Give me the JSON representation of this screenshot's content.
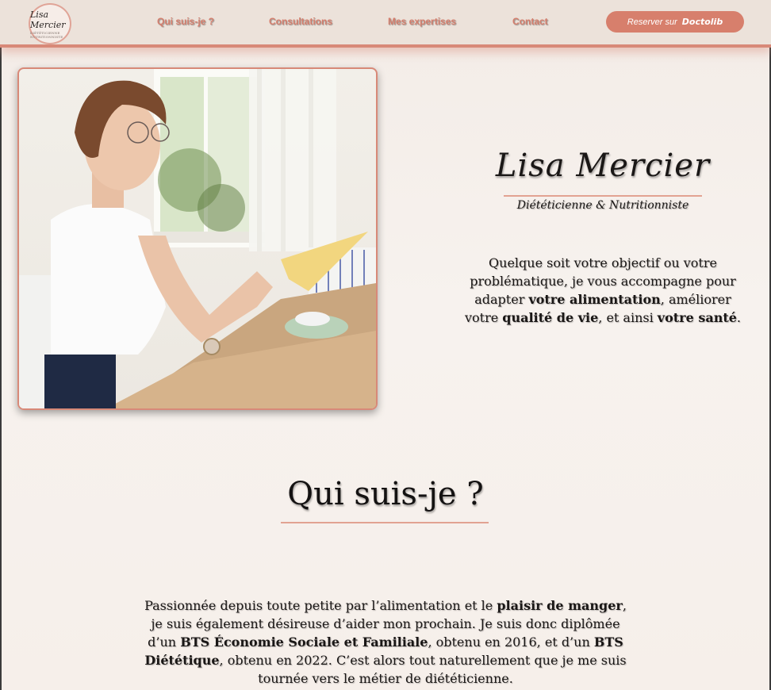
{
  "logo": {
    "script": "Lisa Mercier",
    "subtitle": "DIÉTÉTICIENNE NUTRITIONNISTE"
  },
  "nav": {
    "items": [
      {
        "label": "Qui suis-je ?"
      },
      {
        "label": "Consultations"
      },
      {
        "label": "Mes expertises"
      },
      {
        "label": "Contact"
      }
    ],
    "cta_text": "Reserver sur",
    "cta_brand": "Doctolib"
  },
  "hero": {
    "name": "Lisa Mercier",
    "title": "Diététicienne & Nutritionniste",
    "intro_parts": [
      "Quelque soit votre objectif ou votre problématique, je vous accompagne pour adapter ",
      "votre alimentation",
      ", améliorer votre ",
      "qualité de vie",
      ", et ainsi ",
      "votre santé",
      "."
    ]
  },
  "about": {
    "heading": "Qui suis-je ?",
    "parts": [
      "Passionnée depuis toute petite par l’alimentation et le ",
      "plaisir de manger",
      ", je suis également désireuse d’aider mon prochain. Je suis donc diplômée d’un ",
      "BTS Économie Sociale et Familiale",
      ", obtenu en 2016, et d’un ",
      "BTS Diététique",
      ", obtenu en 2022. C’est alors tout naturellement que je me suis tournée vers le métier de diététicienne."
    ]
  },
  "colors": {
    "accent": "#d77f6c",
    "header_bg": "#ece2da",
    "page_bg": "#f6efea"
  }
}
